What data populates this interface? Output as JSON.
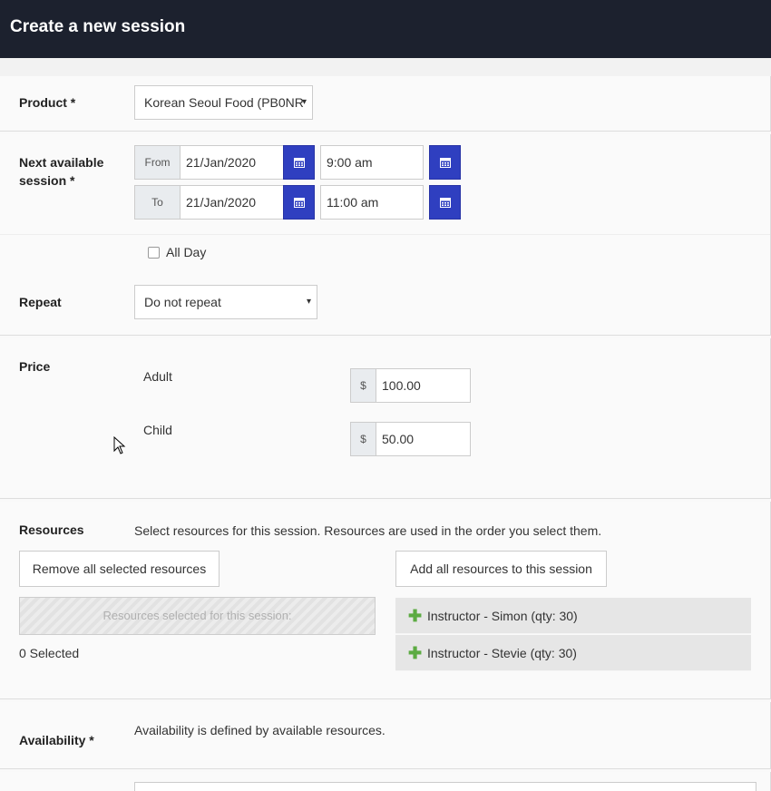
{
  "header": {
    "title": "Create a new session"
  },
  "product": {
    "label": "Product *",
    "selected": "Korean Seoul Food (PB0NR",
    "caret": "▾"
  },
  "session": {
    "label_line1": "Next available",
    "label_line2": "session *",
    "from": {
      "addon": "From",
      "date": "21/Jan/2020",
      "time": "9:00 am"
    },
    "to": {
      "addon": "To",
      "date": "21/Jan/2020",
      "time": "11:00 am"
    },
    "calendar_icon": "calendar-icon"
  },
  "all_day": {
    "label": "All Day",
    "checked": false
  },
  "repeat": {
    "label": "Repeat",
    "selected": "Do not repeat",
    "caret": "▾"
  },
  "price": {
    "label": "Price",
    "rows": [
      {
        "name": "Adult",
        "currency": "$",
        "value": "100.00"
      },
      {
        "name": "Child",
        "currency": "$",
        "value": "50.00"
      }
    ]
  },
  "resources": {
    "label": "Resources",
    "description": "Select resources for this session. Resources are used in the order you select them.",
    "remove_all_label": "Remove all selected resources",
    "add_all_label": "Add all resources to this session",
    "dropzone_placeholder": "Resources selected for this session:",
    "selected_count": "0 Selected",
    "available": [
      {
        "label": "Instructor - Simon (qty: 30)",
        "icon": "plus-icon"
      },
      {
        "label": "Instructor - Stevie (qty: 30)",
        "icon": "plus-icon"
      }
    ],
    "plus_glyph": "✚"
  },
  "availability": {
    "label": "Availability *",
    "description": "Availability is defined by available resources."
  },
  "colors": {
    "header_bg": "#1c212e",
    "calendar_btn": "#2f3fc0",
    "plus_green": "#5cab42"
  }
}
